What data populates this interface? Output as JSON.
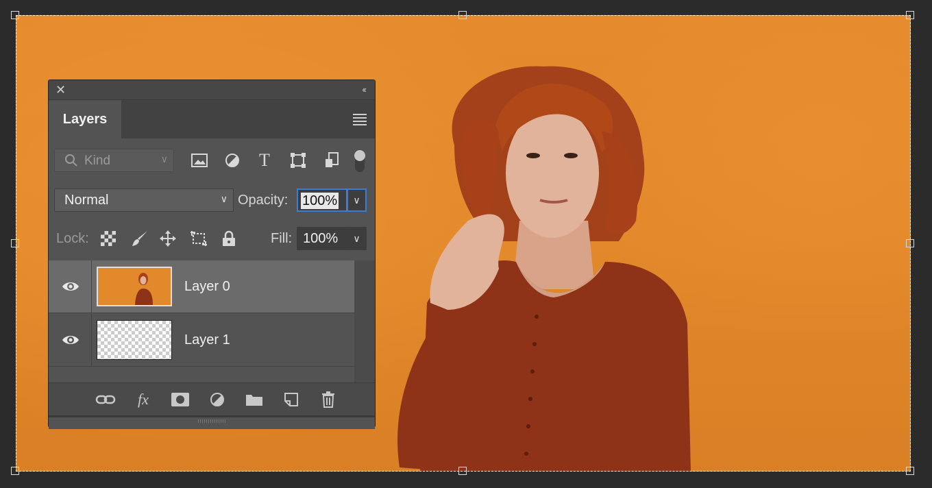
{
  "panel": {
    "tab_label": "Layers",
    "filter": {
      "placeholder": "Kind"
    },
    "blend_mode": "Normal",
    "opacity_label": "Opacity:",
    "opacity_value": "100%",
    "lock_label": "Lock:",
    "fill_label": "Fill:",
    "fill_value": "100%",
    "layers": [
      {
        "name": "Layer 0",
        "visible": true,
        "selected": true
      },
      {
        "name": "Layer 1",
        "visible": true,
        "selected": false
      }
    ],
    "filter_icons": [
      "image-filter-icon",
      "adjustment-filter-icon",
      "type-filter-icon",
      "shape-filter-icon",
      "smart-object-filter-icon"
    ],
    "lock_icons": [
      "lock-transparent-pixels-icon",
      "lock-image-pixels-icon",
      "lock-position-icon",
      "lock-artboard-icon",
      "lock-all-icon"
    ],
    "bottom_icons": [
      "link-layers-icon",
      "layer-style-fx-icon",
      "add-mask-icon",
      "adjustment-layer-icon",
      "group-folder-icon",
      "new-layer-icon",
      "delete-layer-icon"
    ],
    "fx_label": "fx"
  },
  "colors": {
    "accent": "#3d7bd8",
    "wall": "#e2892b",
    "shirt": "#8e3318",
    "panel": "#535353"
  }
}
